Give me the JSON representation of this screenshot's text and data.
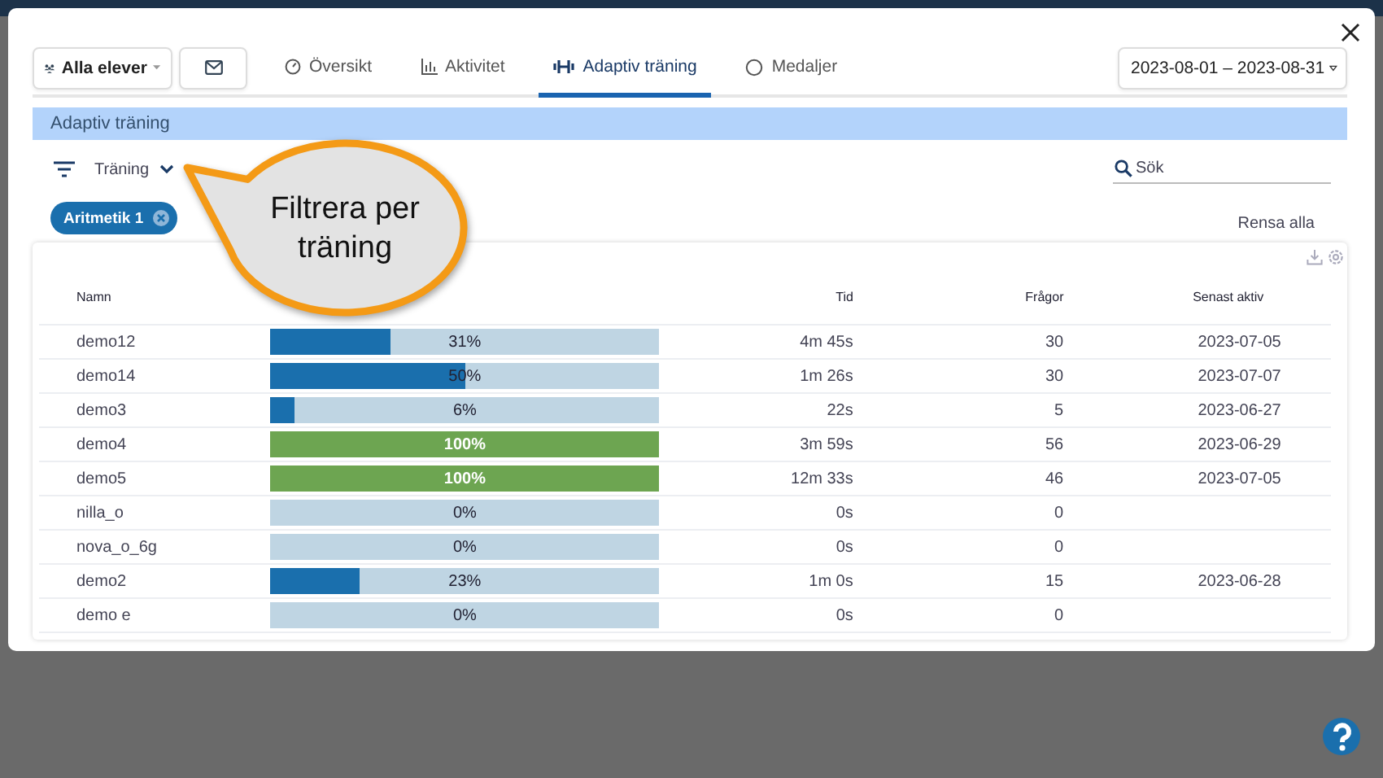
{
  "toolbar": {
    "students_button": "Alla elever",
    "date_range": "2023-08-01 – 2023-08-31"
  },
  "tabs": [
    {
      "label": "Översikt",
      "selected": false
    },
    {
      "label": "Aktivitet",
      "selected": false
    },
    {
      "label": "Adaptiv träning",
      "selected": true
    },
    {
      "label": "Medaljer",
      "selected": false
    }
  ],
  "section_title": "Adaptiv träning",
  "filter": {
    "label": "Träning"
  },
  "search": {
    "placeholder": "Sök"
  },
  "chips": [
    {
      "label": "Aritmetik 1"
    }
  ],
  "clear_all": "Rensa alla",
  "callout": "Filtrera per träning",
  "table": {
    "columns": [
      "Namn",
      "",
      "Tid",
      "Frågor",
      "Senast aktiv"
    ],
    "rows": [
      {
        "name": "demo12",
        "level": 0.31,
        "progress": "31%",
        "time": "4m 45s",
        "questions": "30",
        "last_active": "2023-07-05"
      },
      {
        "name": "demo14",
        "level": 0.5,
        "progress": "50%",
        "time": "1m 26s",
        "questions": "30",
        "last_active": "2023-07-07"
      },
      {
        "name": "demo3",
        "level": 0.06,
        "progress": "6%",
        "time": "22s",
        "questions": "5",
        "last_active": "2023-06-27"
      },
      {
        "name": "demo4",
        "level": 1,
        "progress": "100%",
        "time": "3m 59s",
        "questions": "56",
        "last_active": "2023-06-29"
      },
      {
        "name": "demo5",
        "level": 1,
        "progress": "100%",
        "time": "12m 33s",
        "questions": "46",
        "last_active": "2023-07-05"
      },
      {
        "name": "nilla_o",
        "level": 0,
        "progress": "0%",
        "time": "0s",
        "questions": "0"
      },
      {
        "name": "nova_o_6g",
        "level": 0,
        "progress": "0%",
        "time": "0s",
        "questions": "0"
      },
      {
        "name": "demo2",
        "level": 0.23,
        "progress": "23%",
        "time": "1m 0s",
        "questions": "15",
        "last_active": "2023-06-28"
      },
      {
        "name": "demo e",
        "level": 0,
        "progress": "0%",
        "time": "0s",
        "questions": "0"
      }
    ]
  }
}
